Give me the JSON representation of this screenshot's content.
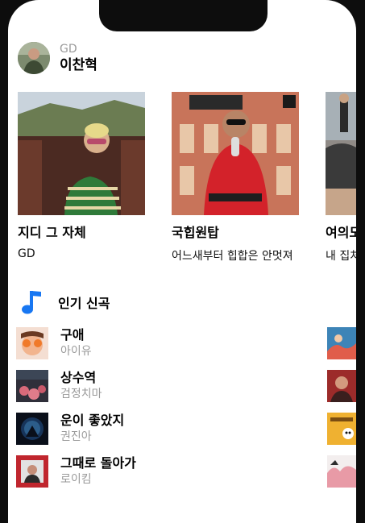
{
  "header": {
    "label": "GD",
    "name": "이찬혁"
  },
  "videos": [
    {
      "title": "지디 그 자체",
      "subtitle": "GD"
    },
    {
      "title": "국힙원탑",
      "subtitle": "어느새부터 힙합은 안멋져"
    },
    {
      "title": "여의도",
      "subtitle": "내 집처럼"
    }
  ],
  "section": {
    "title": "인기 신곡",
    "icon": "music-note-icon",
    "accent": "#1877f2"
  },
  "songs": [
    {
      "title": "구애",
      "artist": "아이유"
    },
    {
      "title": "상수역",
      "artist": "검정치마"
    },
    {
      "title": "운이 좋았지",
      "artist": "권진아"
    },
    {
      "title": "그때로 돌아가",
      "artist": "로이킴"
    }
  ]
}
